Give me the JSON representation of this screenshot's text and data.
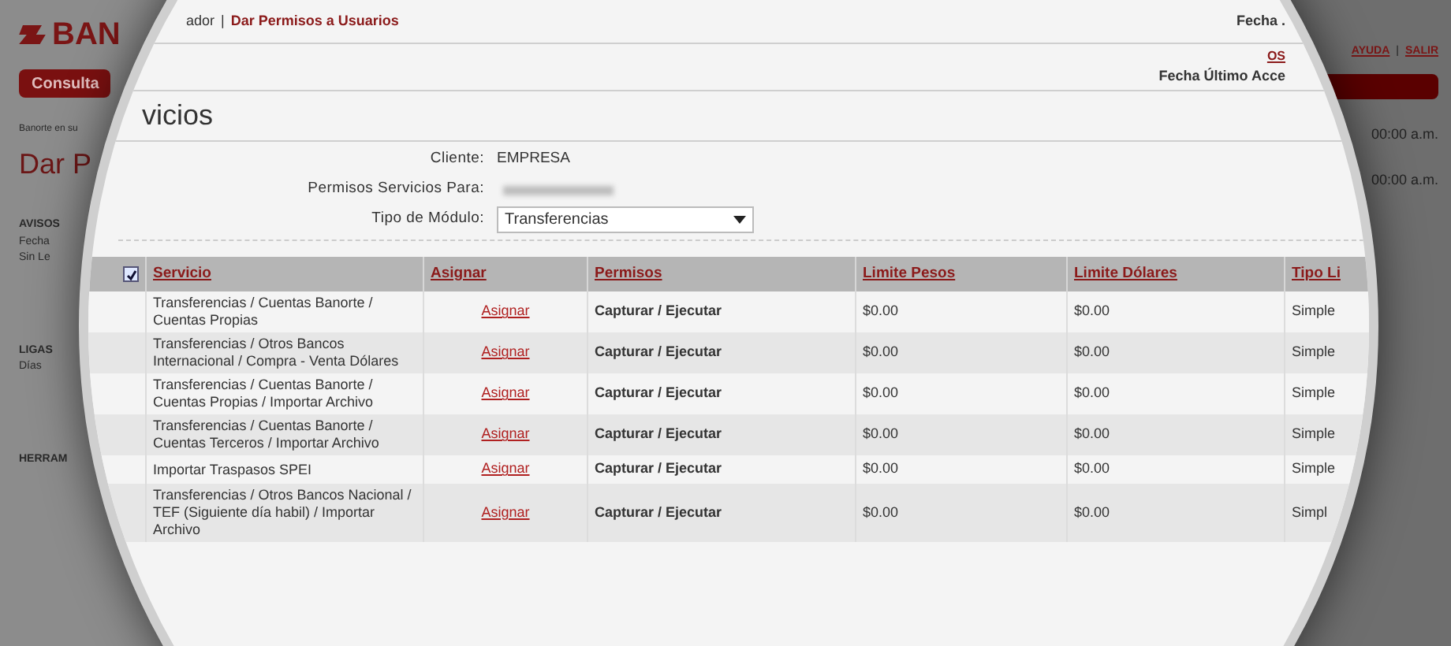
{
  "background_page": {
    "logo": "BAN",
    "menu_button": "Consulta",
    "tagline": "Banorte en su",
    "page_title": "Dar P",
    "left_sections": [
      {
        "heading": "AVISOS",
        "lines": [
          "Fecha",
          "Sin Le"
        ]
      },
      {
        "heading": "LIGAS",
        "lines": [
          "Días"
        ]
      },
      {
        "heading": "HERRAM"
      }
    ],
    "top_links": [
      "AYUDA",
      "SALIR"
    ],
    "link_separator": "|",
    "times": [
      "00:00 a.m.",
      "00:00 a.m."
    ]
  },
  "lens": {
    "breadcrumb": {
      "prefix": "ador",
      "separator": "|",
      "current": "Dar Permisos a Usuarios"
    },
    "header": {
      "date_label": "Fecha .",
      "link_fragment": "OS",
      "last_access_label": "Fecha Último Acce"
    },
    "title": "vicios",
    "form": [
      {
        "kind": "text",
        "label": "Cliente:",
        "value": "EMPRESA"
      },
      {
        "kind": "blurred",
        "label": "Permisos Servicios Para:"
      },
      {
        "kind": "select",
        "label": "Tipo de Módulo:",
        "value": "Transferencias"
      }
    ],
    "table": {
      "select_all": {
        "checked": true
      },
      "columns": [
        "Servicio",
        "Asignar",
        "Permisos",
        "Limite Pesos",
        "Limite Dólares",
        "Tipo Li"
      ],
      "rows": [
        {
          "servicio": "Transferencias / Cuentas Banorte / Cuentas Propias",
          "asignar": "Asignar",
          "permisos": "Capturar / Ejecutar",
          "limite_pesos": "$0.00",
          "limite_dolares": "$0.00",
          "tipo": "Simple"
        },
        {
          "servicio": "Transferencias / Otros Bancos Internacional / Compra - Venta Dólares",
          "asignar": "Asignar",
          "permisos": "Capturar / Ejecutar",
          "limite_pesos": "$0.00",
          "limite_dolares": "$0.00",
          "tipo": "Simple"
        },
        {
          "servicio": "Transferencias / Cuentas Banorte / Cuentas Propias / Importar Archivo",
          "asignar": "Asignar",
          "permisos": "Capturar / Ejecutar",
          "limite_pesos": "$0.00",
          "limite_dolares": "$0.00",
          "tipo": "Simple"
        },
        {
          "servicio": "Transferencias / Cuentas Banorte / Cuentas Terceros / Importar Archivo",
          "asignar": "Asignar",
          "permisos": "Capturar / Ejecutar",
          "limite_pesos": "$0.00",
          "limite_dolares": "$0.00",
          "tipo": "Simple"
        },
        {
          "servicio": "Importar Traspasos SPEI",
          "asignar": "Asignar",
          "permisos": "Capturar / Ejecutar",
          "limite_pesos": "$0.00",
          "limite_dolares": "$0.00",
          "tipo": "Simple"
        },
        {
          "servicio": "Transferencias / Otros Bancos Nacional / TEF (Siguiente día habil) / Importar Archivo",
          "asignar": "Asignar",
          "permisos": "Capturar / Ejecutar",
          "limite_pesos": "$0.00",
          "limite_dolares": "$0.00",
          "tipo": "Simpl"
        }
      ]
    }
  }
}
